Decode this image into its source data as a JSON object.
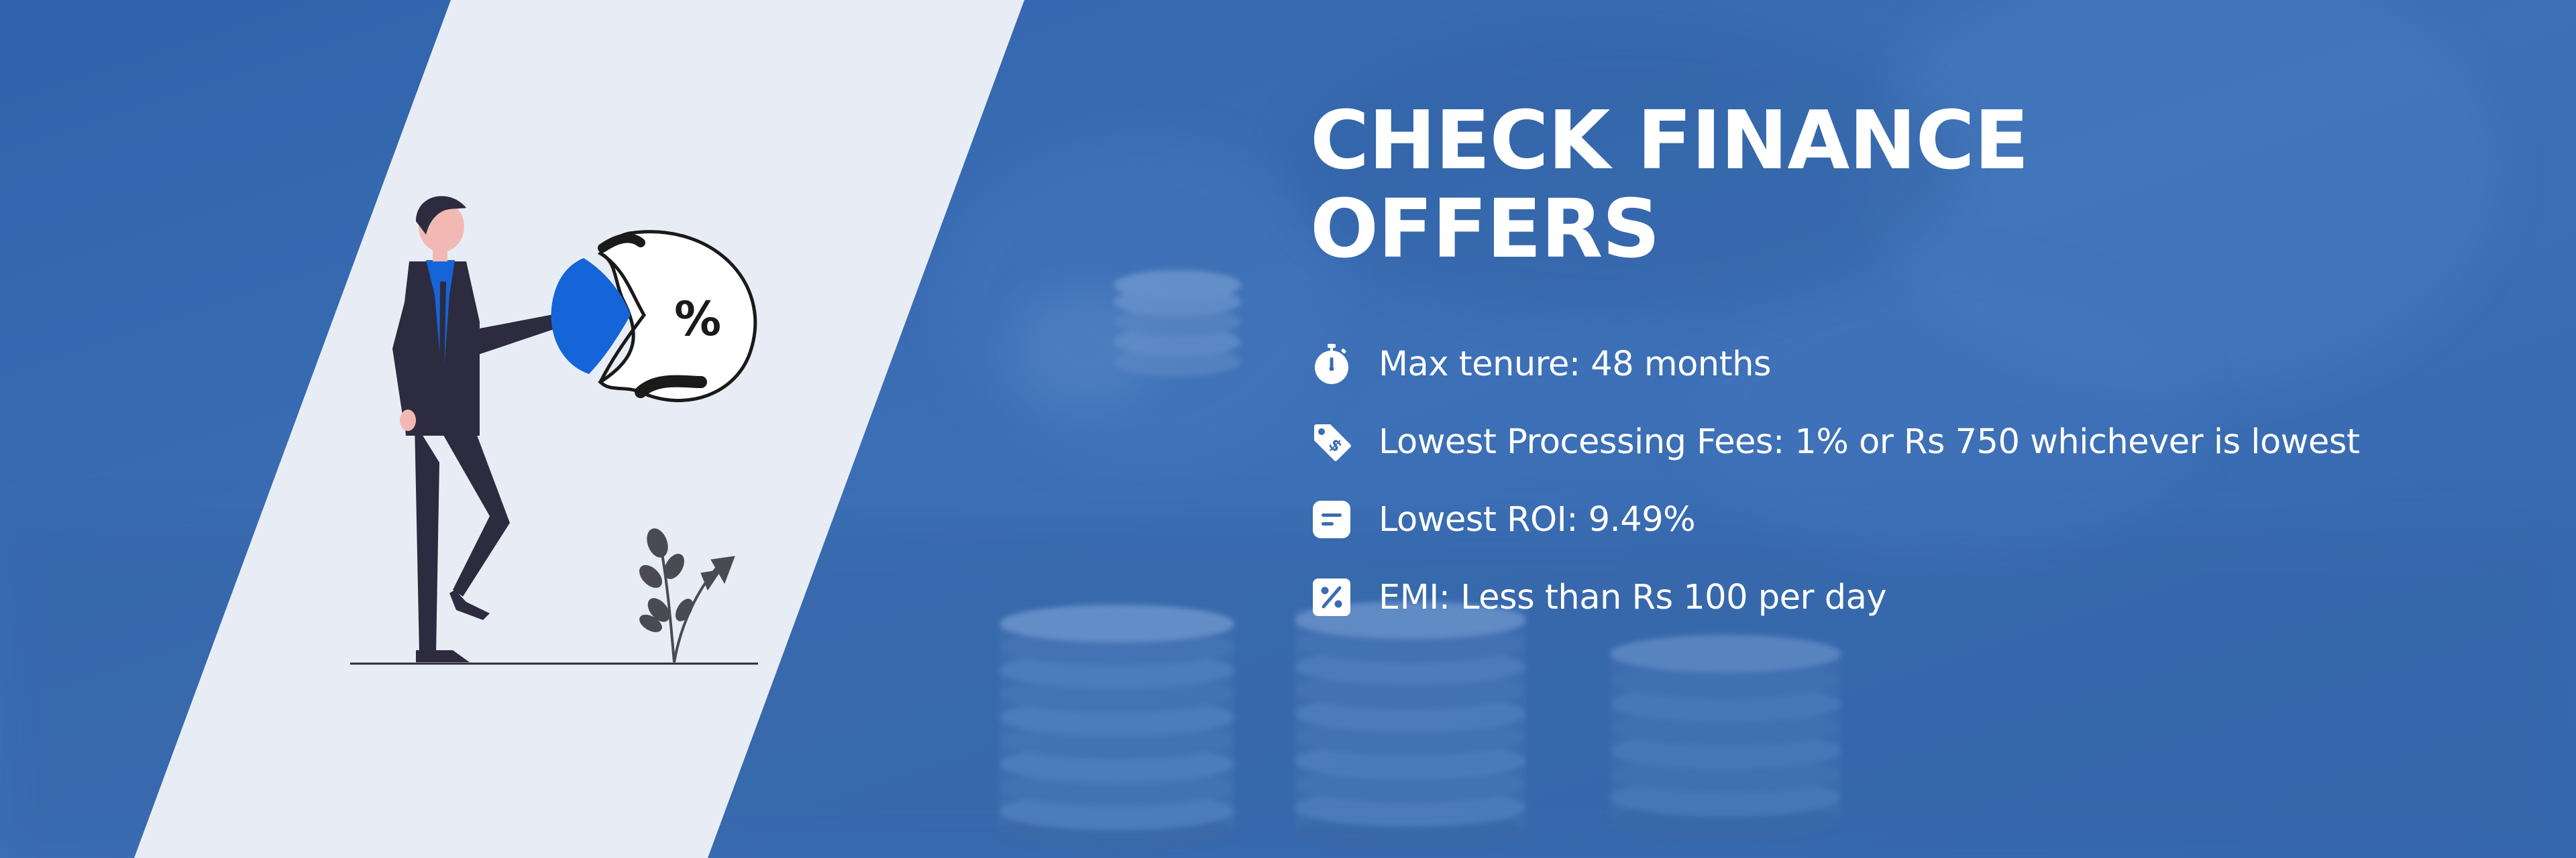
{
  "banner": {
    "headline_line1": "CHECK FINANCE",
    "headline_line2": "OFFERS",
    "features": [
      {
        "icon": "stopwatch-icon",
        "text": "Max tenure: 48 months"
      },
      {
        "icon": "price-tag-icon",
        "text": "Lowest Processing Fees: 1% or Rs 750 whichever is lowest"
      },
      {
        "icon": "document-icon",
        "text": "Lowest ROI: 9.49%"
      },
      {
        "icon": "percent-icon",
        "text": "EMI: Less than Rs 100 per day"
      }
    ],
    "illustration_symbol": "%"
  },
  "colors": {
    "background_blue": "#3a6cb0",
    "panel_light": "#e8edf5",
    "accent_blue": "#1565d8",
    "suit_dark": "#2d2b3f",
    "text_white": "#ffffff"
  }
}
